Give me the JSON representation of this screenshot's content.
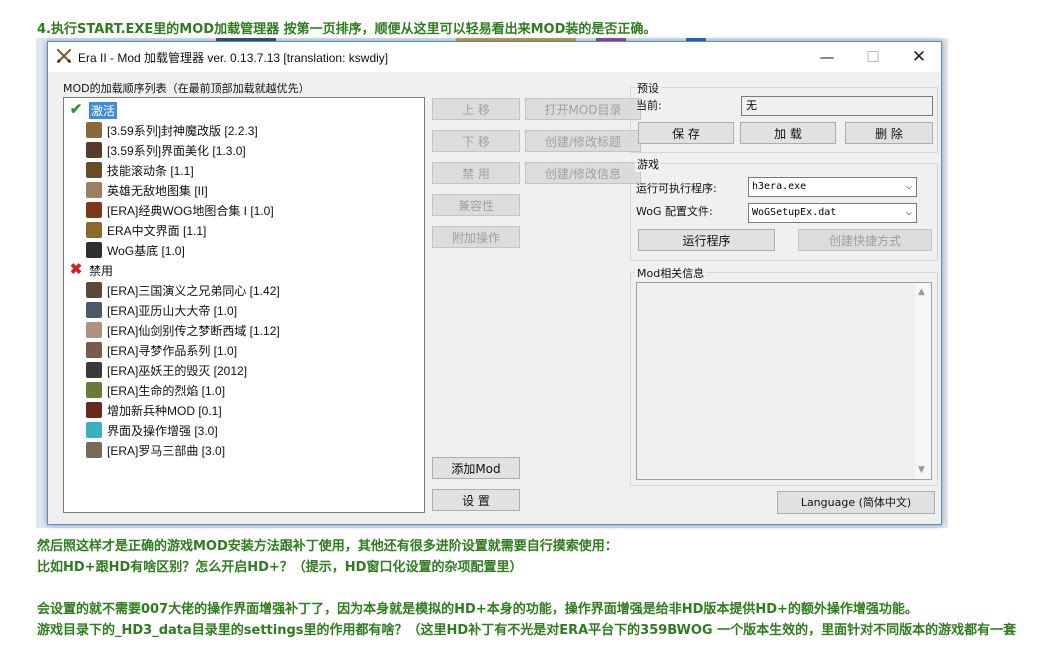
{
  "article": {
    "heading": "4.执行START.EXE里的MOD加载管理器 按第一页排序，顺便从这里可以轻易看出来MOD装的是否正确。",
    "p1": "然后照这样才是正确的游戏MOD安装方法跟补丁使用，其他还有很多进阶设置就需要自行摸索使用：",
    "p2": "比如HD+跟HD有啥区别？怎么开启HD+？（提示，HD窗口化设置的杂项配置里）",
    "p3": "会设置的就不需要007大佬的操作界面增强补丁了，因为本身就是模拟的HD+本身的功能，操作界面增强是给非HD版本提供HD+的额外操作增强功能。",
    "p4": "游戏目录下的_HD3_data目录里的settings里的作用都有啥？（这里HD补丁有不光是对ERA平台下的359BWOG 一个版本生效的，里面针对不同版本的游戏都有一套"
  },
  "window": {
    "title": "Era II - Mod 加载管理器 ver. 0.13.7.13 [translation: kswdiy]",
    "minimize": "—",
    "maximize": "☐",
    "close": "✕"
  },
  "mod_list": {
    "label": "MOD的加载顺序列表（在最前顶部加载就越优先）",
    "enabled_label": "激活",
    "disabled_label": "禁用",
    "enabled": [
      "[3.59系列]封神魔改版 [2.2.3]",
      "[3.59系列]界面美化 [1.3.0]",
      "技能滚动条 [1.1]",
      "英雄无敌地图集 [II]",
      "[ERA]经典WOG地图合集 I  [1.0]",
      "ERA中文界面 [1.1]",
      "WoG基底 [1.0]"
    ],
    "disabled": [
      "[ERA]三国演义之兄弟同心 [1.42]",
      "[ERA]亚历山大大帝 [1.0]",
      "[ERA]仙剑别传之梦断西域 [1.12]",
      "[ERA]寻梦作品系列 [1.0]",
      "[ERA]巫妖王的毁灭 [2012]",
      "[ERA]生命的烈焰 [1.0]",
      "增加新兵种MOD [0.1]",
      "界面及操作增强 [3.0]",
      "[ERA]罗马三部曲 [3.0]"
    ]
  },
  "buttons": {
    "move_up": "上 移",
    "move_down": "下 移",
    "disable": "禁 用",
    "compat": "兼容性",
    "extra_ops": "附加操作",
    "open_mod_dir": "打开MOD目录",
    "edit_title": "创建/修改标题",
    "edit_info": "创建/修改信息",
    "add_mod": "添加Mod",
    "settings": "设 置"
  },
  "preset": {
    "group_label": "预设",
    "current_label": "当前:",
    "current_value": "无",
    "save": "保 存",
    "load": "加 载",
    "delete": "删 除"
  },
  "game": {
    "group_label": "游戏",
    "exe_label": "运行可执行程序:",
    "exe_value": "h3era.exe",
    "wog_label": "WoG 配置文件:",
    "wog_value": "WoGSetupEx.dat",
    "run": "运行程序",
    "shortcut": "创建快捷方式"
  },
  "info": {
    "group_label": "Mod相关信息"
  },
  "language_button": "Language (简体中文)",
  "colors": {
    "accent_green": "#2e7d1e",
    "selection_blue": "#3e8ede",
    "window_border": "#4f8fd4"
  }
}
